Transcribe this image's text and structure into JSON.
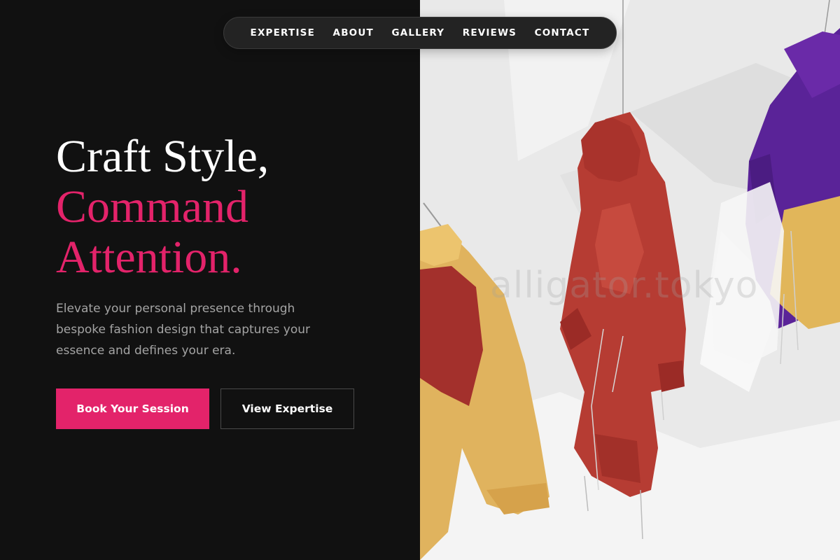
{
  "nav": {
    "items": [
      "EXPERTISE",
      "ABOUT",
      "GALLERY",
      "REVIEWS",
      "CONTACT"
    ]
  },
  "hero": {
    "headline_line1": "Craft Style,",
    "headline_line2": "Command",
    "headline_line3": "Attention.",
    "subtitle": "Elevate your personal presence through bespoke fashion design that captures your essence and defines your era.",
    "primary_button": "Book Your Session",
    "secondary_button": "View Expertise"
  },
  "image": {
    "watermark": "alligator.tokyo"
  },
  "colors": {
    "background": "#111111",
    "accent": "#e3236a",
    "text": "#ffffff",
    "muted_text": "#a4a4a4",
    "nav_background": "#232323"
  }
}
